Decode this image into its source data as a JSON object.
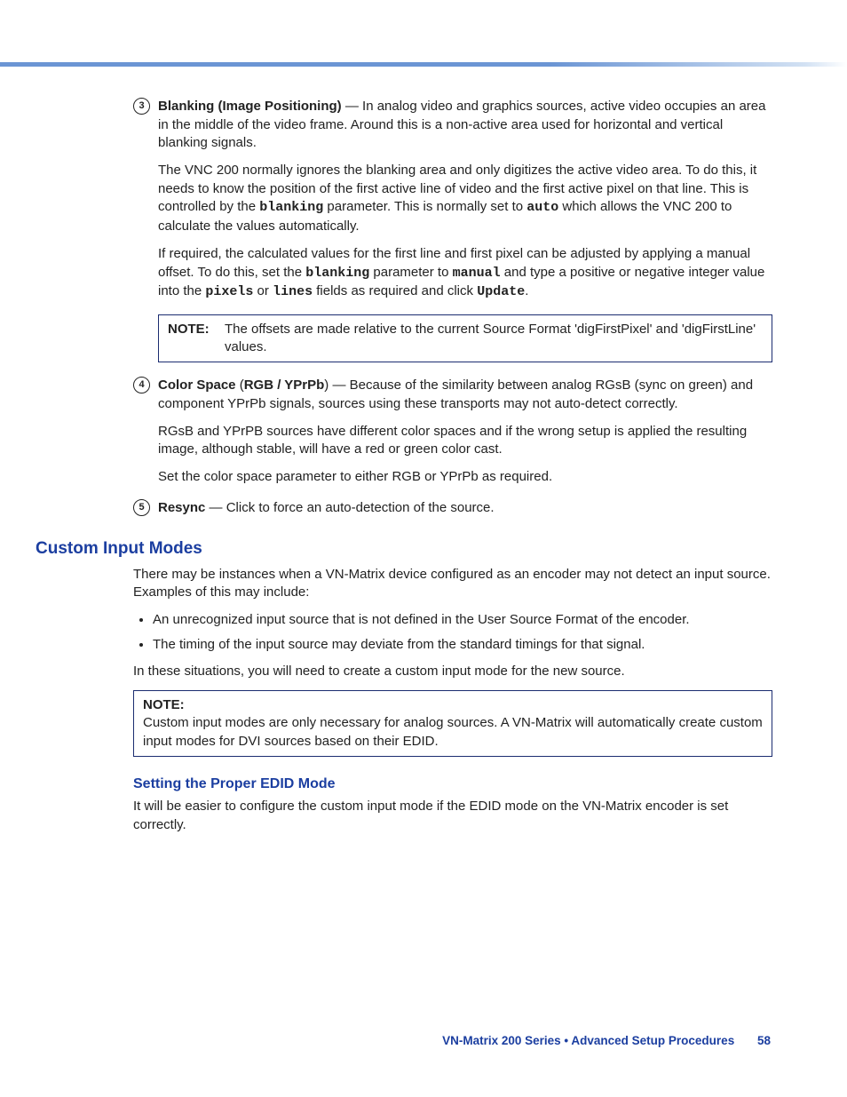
{
  "item3": {
    "num": "3",
    "title": "Blanking (Image Positioning)",
    "p1": " — In analog video and graphics sources, active video occupies an area in the middle of the video frame. Around this is a non-active area used for horizontal and vertical blanking signals.",
    "p2a": "The VNC 200 normally ignores the blanking area and only digitizes the active video area. To do this, it needs to know the position of the first active line of video and the first active pixel on that line. This is controlled by the ",
    "p2_code1": "blanking",
    "p2b": " parameter. This is normally set to ",
    "p2_code2": "auto",
    "p2c": " which allows the VNC 200 to calculate the values automatically.",
    "p3a": "If required, the calculated values for the first line and first pixel can be adjusted by applying a manual offset. To do this, set the ",
    "p3_code1": "blanking",
    "p3b": " parameter to ",
    "p3_code2": "manual",
    "p3c": " and type a positive or negative integer value into the ",
    "p3_code3": "pixels",
    "p3d": " or ",
    "p3_code4": "lines",
    "p3e": " fields as required and click ",
    "p3_code5": "Update",
    "p3f": ".",
    "note_label": "NOTE:",
    "note_text": "The offsets are made relative to the current Source Format 'digFirstPixel' and 'digFirstLine' values."
  },
  "item4": {
    "num": "4",
    "title": "Color Space",
    "title_paren": "RGB / YPrPb",
    "p1": ") — Because of the similarity between analog RGsB (sync on green) and component YPrPb signals, sources using these transports may not auto-detect correctly.",
    "p2": "RGsB and YPrPB sources have different color spaces and if the wrong setup is applied the resulting image, although stable, will have a red or green color cast.",
    "p3": "Set the color space parameter to either RGB or YPrPb as required."
  },
  "item5": {
    "num": "5",
    "title": "Resync",
    "p1": " — Click to force an auto-detection of the source."
  },
  "custom": {
    "heading": "Custom Input Modes",
    "intro": "There may be instances when a VN-Matrix device configured as an encoder may not detect an input source. Examples of this may include:",
    "b1": "An unrecognized input source that is not defined in the User Source Format of the encoder.",
    "b2": "The timing of the input source may deviate from the standard timings for that signal.",
    "outro": "In these situations, you will need to create a custom input mode for the new source.",
    "note_label": "NOTE:",
    "note_text": "Custom input modes are only necessary for analog sources. A VN-Matrix will automatically create custom input modes for DVI sources based on their EDID."
  },
  "edid": {
    "heading": "Setting the Proper EDID Mode",
    "p1": "It will be easier to configure the custom input mode if the EDID mode on the VN-Matrix encoder is set correctly."
  },
  "footer": {
    "text": "VN-Matrix 200 Series  •  Advanced Setup Procedures",
    "page": "58"
  }
}
